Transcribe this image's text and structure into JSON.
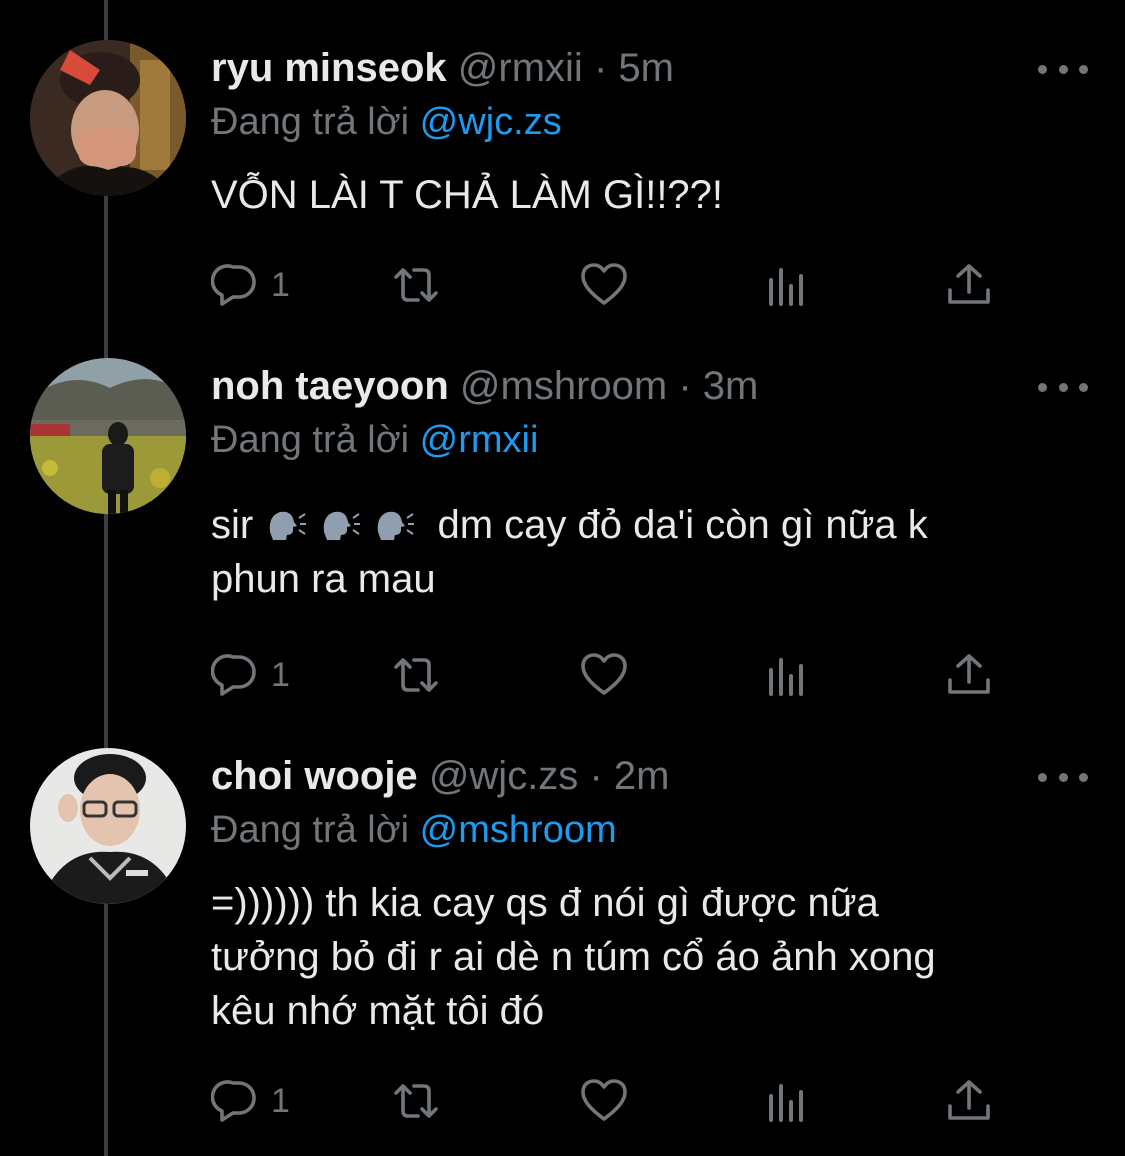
{
  "colors": {
    "background": "#000000",
    "text": "#e7e9ea",
    "muted": "#71767b",
    "mention": "#1d9bf0",
    "thread_line": "#3a3d41"
  },
  "tweets": [
    {
      "name": "ryu minseok",
      "handle": "@rmxii",
      "time": "· 5m",
      "reply_prefix": "Đang trả lời",
      "reply_to": "@wjc.zs",
      "text": "VỖN LÀI T CHẢ LÀM GÌ!!??!",
      "reply_count": "1"
    },
    {
      "name": "noh taeyoon",
      "handle": "@mshroom",
      "time": "· 3m",
      "reply_prefix": "Đang trả lời",
      "reply_to": "@rmxii",
      "text_start": "sir",
      "emoji_names": [
        "speaking-head-icon",
        "speaking-head-icon",
        "speaking-head-icon"
      ],
      "text_rest": "dm cay đỏ da'i còn gì nữa k",
      "text_line2": "phun ra mau",
      "reply_count": "1"
    },
    {
      "name": "choi wooje",
      "handle": "@wjc.zs",
      "time": "· 2m",
      "reply_prefix": "Đang trả lời",
      "reply_to": "@mshroom",
      "text_lines": [
        "=)))))) th kia cay qs đ nói gì được nữa",
        "tưởng bỏ đi r ai dè n túm cổ áo ảnh xong",
        "kêu nhớ mặt tôi đó"
      ],
      "reply_count": "1"
    }
  ],
  "icons": {
    "reply": "reply-icon",
    "retweet": "retweet-icon",
    "like": "heart-icon",
    "views": "views-icon",
    "share": "share-icon",
    "more": "more-icon"
  }
}
